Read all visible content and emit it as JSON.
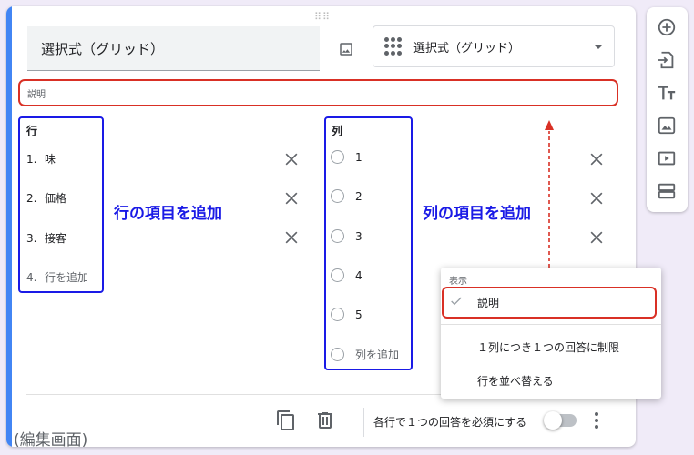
{
  "question": {
    "title": "選択式（グリッド）",
    "type_label": "選択式（グリッド）",
    "description_placeholder": "説明"
  },
  "rows": {
    "heading": "行",
    "items": [
      {
        "num": "1.",
        "label": "味"
      },
      {
        "num": "2.",
        "label": "価格"
      },
      {
        "num": "3.",
        "label": "接客"
      }
    ],
    "add": {
      "num": "4.",
      "label": "行を追加"
    }
  },
  "columns": {
    "heading": "列",
    "items": [
      "1",
      "2",
      "3",
      "4",
      "5"
    ],
    "add_label": "列を追加"
  },
  "annotations": {
    "rows": "行の項目を追加",
    "columns": "列の項目を追加",
    "edit_screen": "(編集画面)"
  },
  "footer": {
    "required_label": "各行で１つの回答を必須にする"
  },
  "menu": {
    "header": "表示",
    "items": [
      "説明",
      "１列につき１つの回答に制限",
      "行を並べ替える"
    ]
  },
  "colors": {
    "accent": "#4285f4",
    "highlight_red": "#d93025",
    "annotation_blue": "#1a1ae6"
  }
}
